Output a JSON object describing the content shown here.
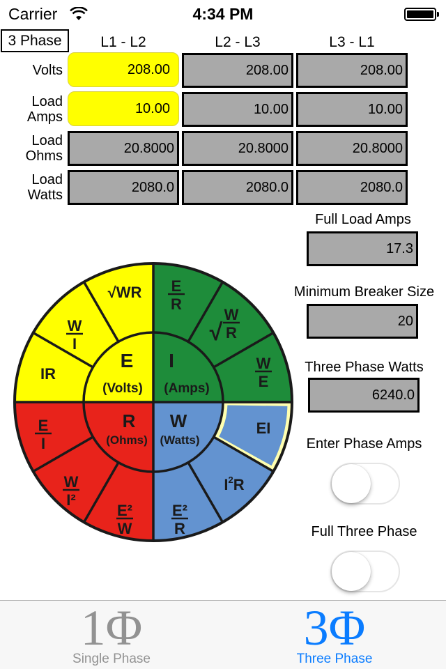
{
  "status_bar": {
    "carrier": "Carrier",
    "time": "4:34 PM",
    "wifi_icon": "wifi-icon",
    "battery_icon": "battery-full-icon"
  },
  "phase_label": "3 Phase",
  "columns": [
    "L1 - L2",
    "L2 - L3",
    "L3 - L1"
  ],
  "rows": [
    {
      "label_line1": "Volts",
      "label_line2": "",
      "values": [
        "208.00",
        "208.00",
        "208.00"
      ],
      "editable": [
        true,
        false,
        false
      ]
    },
    {
      "label_line1": "Load",
      "label_line2": "Amps",
      "values": [
        "10.00",
        "10.00",
        "10.00"
      ],
      "editable": [
        true,
        false,
        false
      ]
    },
    {
      "label_line1": "Load",
      "label_line2": "Ohms",
      "values": [
        "20.8000",
        "20.8000",
        "20.8000"
      ],
      "editable": [
        false,
        false,
        false
      ]
    },
    {
      "label_line1": "Load",
      "label_line2": "Watts",
      "values": [
        "2080.0",
        "2080.0",
        "2080.0"
      ],
      "editable": [
        false,
        false,
        false
      ]
    }
  ],
  "results": {
    "full_load_amps": {
      "label": "Full Load Amps",
      "value": "17.3"
    },
    "min_breaker": {
      "label": "Minimum Breaker Size",
      "value": "20"
    },
    "three_phase_watts": {
      "label": "Three Phase Watts",
      "value": "6240.0"
    }
  },
  "toggles": {
    "enter_phase_amps": {
      "label": "Enter Phase Amps",
      "on": false
    },
    "full_three_phase": {
      "label": "Full Three Phase",
      "on": false
    }
  },
  "wheel": {
    "colors": {
      "volts": "#ffff00",
      "amps": "#1e8c3a",
      "ohms": "#e8231b",
      "watts": "#6393d0",
      "highlight": "#ffffb0"
    },
    "center": {
      "volts": {
        "symbol": "E",
        "unit": "(Volts)"
      },
      "amps": {
        "symbol": "I",
        "unit": "(Amps)"
      },
      "ohms": {
        "symbol": "R",
        "unit": "(Ohms)"
      },
      "watts": {
        "symbol": "W",
        "unit": "(Watts)"
      }
    },
    "formulas": {
      "volts": [
        "IR",
        "W/I",
        "√WR"
      ],
      "amps": [
        "E/R",
        "√(W/R)",
        "W/E"
      ],
      "watts": [
        "EI",
        "I²R",
        "E²/R"
      ],
      "ohms": [
        "E²/W",
        "W/I²",
        "E/I"
      ]
    },
    "selected_formula": "EI"
  },
  "tab_bar": {
    "tabs": [
      {
        "icon": "1Φ",
        "label": "Single Phase",
        "active": false
      },
      {
        "icon": "3Φ",
        "label": "Three Phase",
        "active": true
      }
    ],
    "active_color": "#0a7cff",
    "inactive_color": "#929292"
  }
}
